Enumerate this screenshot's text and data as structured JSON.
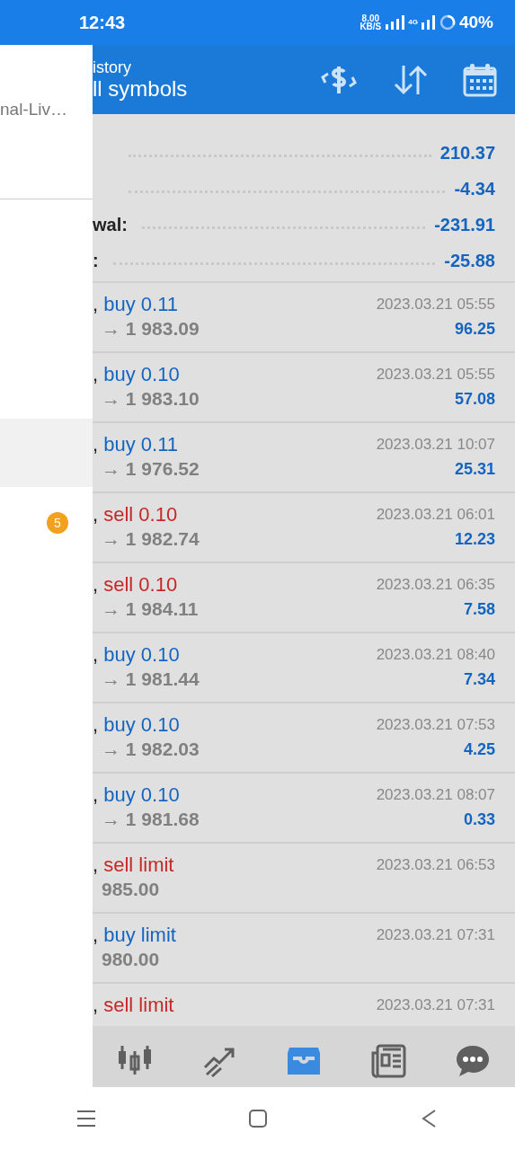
{
  "status_bar": {
    "time": "12:43",
    "speed": "8.00",
    "speed_unit": "KB/S",
    "network": "4G",
    "battery": "40%"
  },
  "drawer": {
    "account": "nal-Liv…",
    "items": [
      {
        "selected": true
      },
      {
        "selected": false
      }
    ],
    "badge": "5"
  },
  "header": {
    "title": "istory",
    "subtitle": "ll symbols"
  },
  "summary": [
    {
      "value": "210.37"
    },
    {
      "value": "-4.34"
    },
    {
      "label": "wal:",
      "value": "-231.91"
    },
    {
      "label": ":",
      "value": "-25.88"
    }
  ],
  "trades": [
    {
      "kind": "buy",
      "symbol_tail": ",",
      "action": "buy 0.11",
      "prices": "→ 1 983.09",
      "time": "2023.03.21 05:55",
      "profit": "96.25"
    },
    {
      "kind": "buy",
      "symbol_tail": ",",
      "action": "buy 0.10",
      "prices": "→ 1 983.10",
      "time": "2023.03.21 05:55",
      "profit": "57.08"
    },
    {
      "kind": "buy",
      "symbol_tail": ",",
      "action": "buy 0.11",
      "prices": "→ 1 976.52",
      "time": "2023.03.21 10:07",
      "profit": "25.31"
    },
    {
      "kind": "sell",
      "symbol_tail": ",",
      "action": "sell 0.10",
      "prices": "→ 1 982.74",
      "time": "2023.03.21 06:01",
      "profit": "12.23"
    },
    {
      "kind": "sell",
      "symbol_tail": ",",
      "action": "sell 0.10",
      "prices": "→ 1 984.11",
      "time": "2023.03.21 06:35",
      "profit": "7.58"
    },
    {
      "kind": "buy",
      "symbol_tail": ",",
      "action": "buy 0.10",
      "prices": "→ 1 981.44",
      "time": "2023.03.21 08:40",
      "profit": "7.34"
    },
    {
      "kind": "buy",
      "symbol_tail": ",",
      "action": "buy 0.10",
      "prices": "→ 1 982.03",
      "time": "2023.03.21 07:53",
      "profit": "4.25"
    },
    {
      "kind": "buy",
      "symbol_tail": ",",
      "action": "buy 0.10",
      "prices": "→ 1 981.68",
      "time": "2023.03.21 08:07",
      "profit": "0.33"
    },
    {
      "kind": "sell",
      "symbol_tail": ",",
      "action": "sell limit",
      "prices": "985.00",
      "time": "2023.03.21 06:53"
    },
    {
      "kind": "buy",
      "symbol_tail": ",",
      "action": "buy limit",
      "prices": "980.00",
      "time": "2023.03.21 07:31"
    },
    {
      "kind": "sell",
      "symbol_tail": ",",
      "action": "sell limit",
      "time": "2023.03.21 07:31"
    }
  ],
  "tab_bar": [
    {
      "kind": "quotes",
      "selected": false
    },
    {
      "kind": "trade",
      "selected": false
    },
    {
      "kind": "history",
      "selected": true
    },
    {
      "kind": "news",
      "selected": false
    },
    {
      "kind": "chat",
      "selected": false
    }
  ],
  "nav_bar": [
    {
      "kind": "menu"
    },
    {
      "kind": "home"
    },
    {
      "kind": "back"
    }
  ]
}
